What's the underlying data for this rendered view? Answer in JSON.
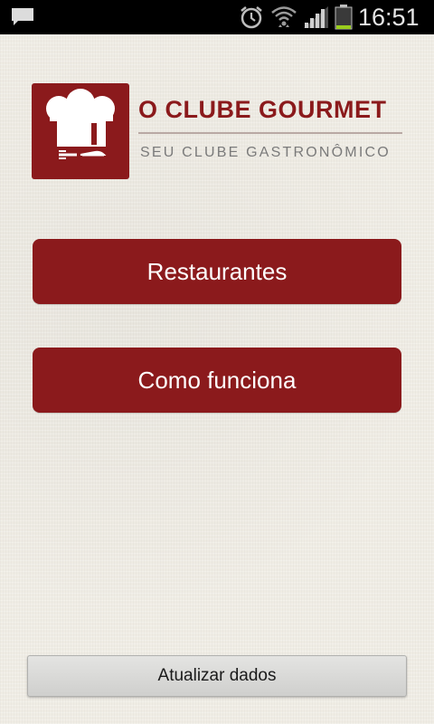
{
  "status_bar": {
    "time": "16:51",
    "icons": [
      "notification-icon",
      "alarm-icon",
      "wifi-icon",
      "signal-icon",
      "battery-icon"
    ]
  },
  "logo": {
    "title": "O CLUBE GOURMET",
    "subtitle": "SEU CLUBE GASTRONÔMICO"
  },
  "menu": {
    "restaurants_label": "Restaurantes",
    "how_it_works_label": "Como funciona"
  },
  "footer": {
    "update_label": "Atualizar dados"
  },
  "colors": {
    "brand": "#8b1a1c",
    "background": "#efece4",
    "status_bar": "#000000"
  }
}
